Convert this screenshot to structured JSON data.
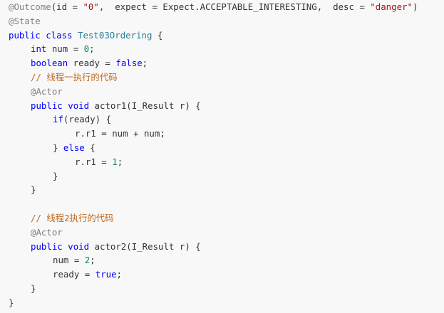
{
  "code": {
    "lines": [
      {
        "indent": 0,
        "tokens": [
          {
            "t": "an",
            "v": "@Outcome"
          },
          {
            "t": "tx",
            "v": "(id = "
          },
          {
            "t": "str",
            "v": "\"0\""
          },
          {
            "t": "tx",
            "v": ",  expect = Expect.ACCEPTABLE_INTERESTING,  desc = "
          },
          {
            "t": "str",
            "v": "\"danger\""
          },
          {
            "t": "tx",
            "v": ")"
          }
        ]
      },
      {
        "indent": 0,
        "tokens": [
          {
            "t": "an",
            "v": "@State"
          }
        ]
      },
      {
        "indent": 0,
        "tokens": [
          {
            "t": "kw",
            "v": "public"
          },
          {
            "t": "tx",
            "v": " "
          },
          {
            "t": "kw",
            "v": "class"
          },
          {
            "t": "tx",
            "v": " "
          },
          {
            "t": "cls",
            "v": "Test03Ordering"
          },
          {
            "t": "tx",
            "v": " {"
          }
        ]
      },
      {
        "indent": 1,
        "tokens": [
          {
            "t": "kw",
            "v": "int"
          },
          {
            "t": "tx",
            "v": " num = "
          },
          {
            "t": "num",
            "v": "0"
          },
          {
            "t": "tx",
            "v": ";"
          }
        ]
      },
      {
        "indent": 1,
        "tokens": [
          {
            "t": "kw",
            "v": "boolean"
          },
          {
            "t": "tx",
            "v": " ready = "
          },
          {
            "t": "kw",
            "v": "false"
          },
          {
            "t": "tx",
            "v": ";"
          }
        ]
      },
      {
        "indent": 1,
        "tokens": [
          {
            "t": "cm",
            "v": "// 线程一执行的代码"
          }
        ]
      },
      {
        "indent": 1,
        "tokens": [
          {
            "t": "an",
            "v": "@Actor"
          }
        ]
      },
      {
        "indent": 1,
        "tokens": [
          {
            "t": "kw",
            "v": "public"
          },
          {
            "t": "tx",
            "v": " "
          },
          {
            "t": "kw",
            "v": "void"
          },
          {
            "t": "tx",
            "v": " actor1(I_Result r) {"
          }
        ]
      },
      {
        "indent": 2,
        "tokens": [
          {
            "t": "kw",
            "v": "if"
          },
          {
            "t": "tx",
            "v": "(ready) {"
          }
        ]
      },
      {
        "indent": 3,
        "tokens": [
          {
            "t": "tx",
            "v": "r.r1 = num + num;"
          }
        ]
      },
      {
        "indent": 2,
        "tokens": [
          {
            "t": "tx",
            "v": "} "
          },
          {
            "t": "kw",
            "v": "else"
          },
          {
            "t": "tx",
            "v": " {"
          }
        ]
      },
      {
        "indent": 3,
        "tokens": [
          {
            "t": "tx",
            "v": "r.r1 = "
          },
          {
            "t": "num",
            "v": "1"
          },
          {
            "t": "tx",
            "v": ";"
          }
        ]
      },
      {
        "indent": 2,
        "tokens": [
          {
            "t": "tx",
            "v": "}"
          }
        ]
      },
      {
        "indent": 1,
        "tokens": [
          {
            "t": "tx",
            "v": "}"
          }
        ]
      },
      {
        "indent": 0,
        "tokens": []
      },
      {
        "indent": 1,
        "tokens": [
          {
            "t": "cm",
            "v": "// 线程2执行的代码"
          }
        ]
      },
      {
        "indent": 1,
        "tokens": [
          {
            "t": "an",
            "v": "@Actor"
          }
        ]
      },
      {
        "indent": 1,
        "tokens": [
          {
            "t": "kw",
            "v": "public"
          },
          {
            "t": "tx",
            "v": " "
          },
          {
            "t": "kw",
            "v": "void"
          },
          {
            "t": "tx",
            "v": " actor2(I_Result r) {"
          }
        ]
      },
      {
        "indent": 2,
        "tokens": [
          {
            "t": "tx",
            "v": "num = "
          },
          {
            "t": "num",
            "v": "2"
          },
          {
            "t": "tx",
            "v": ";"
          }
        ]
      },
      {
        "indent": 2,
        "tokens": [
          {
            "t": "tx",
            "v": "ready = "
          },
          {
            "t": "kw",
            "v": "true"
          },
          {
            "t": "tx",
            "v": ";"
          }
        ]
      },
      {
        "indent": 1,
        "tokens": [
          {
            "t": "tx",
            "v": "}"
          }
        ]
      },
      {
        "indent": 0,
        "tokens": [
          {
            "t": "tx",
            "v": "}"
          }
        ]
      }
    ]
  },
  "colors": {
    "background": "#f8f8f8",
    "keyword": "#0000ff",
    "string": "#a31515",
    "number": "#098658",
    "comment": "#c0671a",
    "annotation": "#808080",
    "class_name": "#267f99",
    "text": "#333333"
  }
}
